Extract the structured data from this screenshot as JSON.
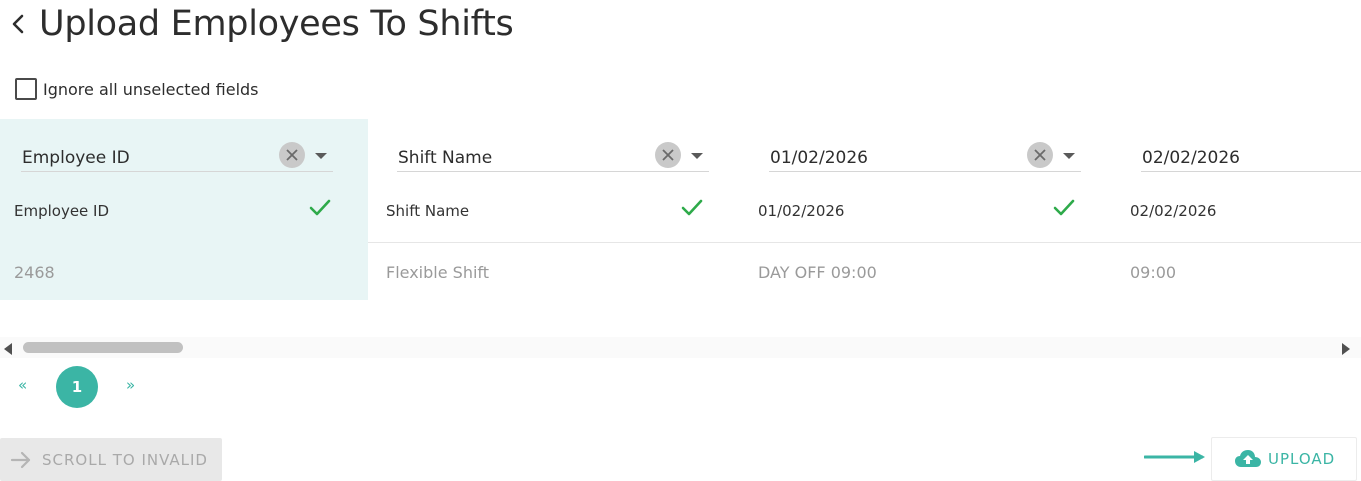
{
  "header": {
    "title": "Upload Employees To Shifts",
    "back_icon": "chevron-left-icon"
  },
  "options": {
    "ignore_unselected_label": "Ignore all unselected fields",
    "ignore_unselected_checked": false
  },
  "columns": [
    {
      "selected_field": "Employee ID",
      "header": "Employee ID",
      "first_value": "2468",
      "matched": true,
      "highlighted": true
    },
    {
      "selected_field": "Shift Name",
      "header": "Shift Name",
      "first_value": "Flexible Shift",
      "matched": true,
      "highlighted": false
    },
    {
      "selected_field": "01/02/2026",
      "header": "01/02/2026",
      "first_value": "DAY OFF 09:00",
      "matched": true,
      "highlighted": false
    },
    {
      "selected_field": "02/02/2026",
      "header": "02/02/2026",
      "first_value": "09:00",
      "matched": false,
      "highlighted": false
    }
  ],
  "pagination": {
    "first": "«",
    "current": "1",
    "last": "»"
  },
  "actions": {
    "scroll_to_invalid_label": "SCROLL TO INVALID",
    "upload_label": "UPLOAD"
  },
  "colors": {
    "accent": "#3bb5a5",
    "selected_column_bg": "#e8f5f5",
    "check_green": "#2eaa4a",
    "disabled_text": "#a9a9a9"
  }
}
